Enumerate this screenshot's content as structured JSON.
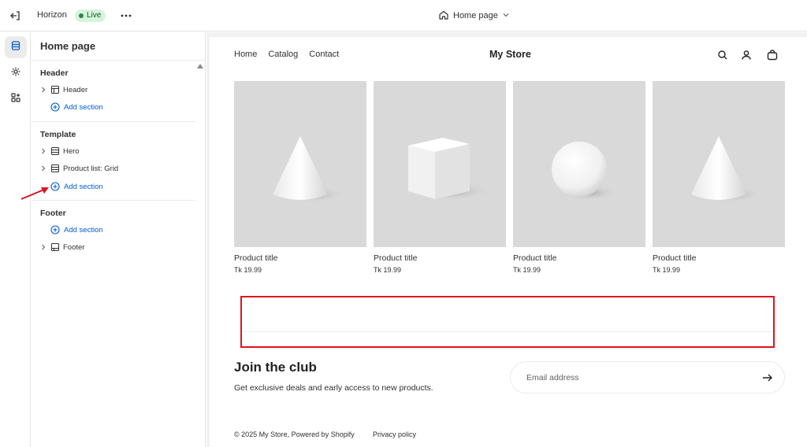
{
  "topbar": {
    "theme_name": "Horizon",
    "live_badge": "Live",
    "page_selector": "Home page"
  },
  "sidebar": {
    "title": "Home page",
    "groups": {
      "header": {
        "label": "Header",
        "items": [
          "Header"
        ],
        "add_label": "Add section"
      },
      "template": {
        "label": "Template",
        "items": [
          "Hero",
          "Product list: Grid"
        ],
        "add_label": "Add section"
      },
      "footer": {
        "label": "Footer",
        "add_label": "Add section",
        "items": [
          "Footer"
        ]
      }
    }
  },
  "store": {
    "nav": [
      "Home",
      "Catalog",
      "Contact"
    ],
    "name": "My Store",
    "products": [
      {
        "title": "Product title",
        "price": "Tk 19.99",
        "shape": "cone"
      },
      {
        "title": "Product title",
        "price": "Tk 19.99",
        "shape": "cube"
      },
      {
        "title": "Product title",
        "price": "Tk 19.99",
        "shape": "sphere"
      },
      {
        "title": "Product title",
        "price": "Tk 19.99",
        "shape": "cone"
      }
    ],
    "newsletter": {
      "title": "Join the club",
      "subtitle": "Get exclusive deals and early access to new products.",
      "email_placeholder": "Email address"
    },
    "footer": {
      "copyright": "© 2025 My Store, Powered by Shopify",
      "privacy": "Privacy policy"
    }
  },
  "colors": {
    "accent": "#005bd3",
    "live_bg": "#d5f5d9",
    "live_text": "#0c5132",
    "highlight": "#e0141e"
  },
  "icons": [
    "exit-icon",
    "more-icon",
    "home-icon",
    "chevron-down-icon",
    "sections-icon",
    "settings-icon",
    "apps-icon",
    "chevron-right-icon",
    "section-header-icon",
    "section-hero-icon",
    "section-grid-icon",
    "section-footer-icon",
    "plus-circle-icon",
    "search-icon",
    "account-icon",
    "cart-icon",
    "arrow-right-icon"
  ]
}
